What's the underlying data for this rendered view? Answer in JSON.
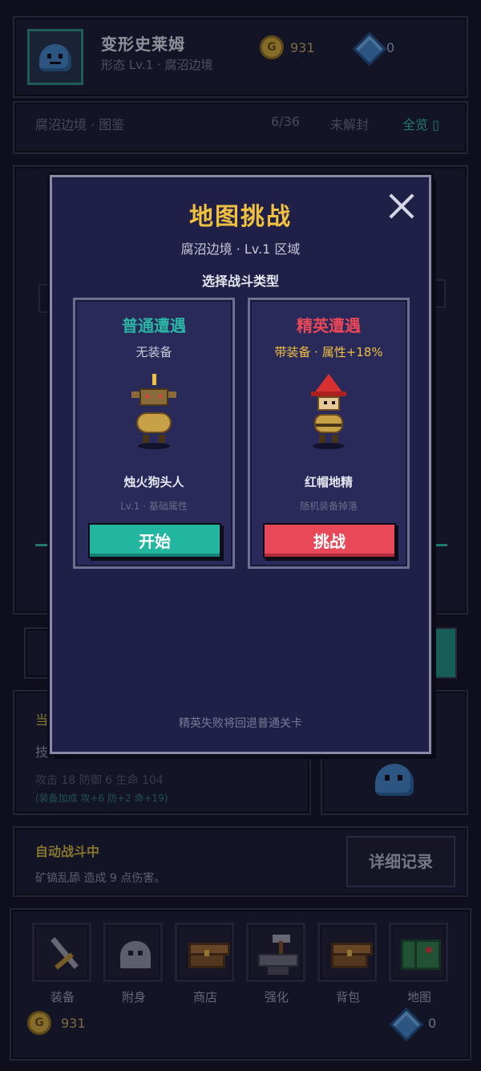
{
  "header": {
    "name": "变形史莱姆",
    "subtitle": "形态 Lv.1 · 腐沼边境",
    "gold": "931",
    "gems": "0"
  },
  "subheader": {
    "area": "腐沼边境 · 图鉴",
    "progress": "6/36",
    "locked": "未解封",
    "view_all": "全览 ▯"
  },
  "stats": {
    "label_current": "当",
    "label_skill": "技",
    "line": "攻击 18  防御 6  生命 104",
    "bonus": "(装备加成 攻+6 防+2 命+19)"
  },
  "log": {
    "title": "自动战斗中",
    "text": "矿镐乱舔 造成 9 点伤害。",
    "detail_button": "详细记录"
  },
  "nav": {
    "items": [
      {
        "label": "装备"
      },
      {
        "label": "附身"
      },
      {
        "label": "商店"
      },
      {
        "label": "强化"
      },
      {
        "label": "背包"
      },
      {
        "label": "地图"
      }
    ],
    "gold": "931",
    "gems": "0"
  },
  "modal": {
    "title": "地图挑战",
    "subtitle": "腐沼边境 · Lv.1 区域",
    "prompt": "选择战斗类型",
    "footer": "精英失败将回退普通关卡",
    "cards": [
      {
        "title": "普通遭遇",
        "tag": "无装备",
        "monster": "烛火狗头人",
        "desc": "Lv.1 · 基础属性",
        "button": "开始",
        "title_color": "#2bb5a5"
      },
      {
        "title": "精英遭遇",
        "tag": "带装备 · 属性+18%",
        "monster": "红帽地精",
        "desc": "随机装备掉落",
        "button": "挑战",
        "title_color": "#e84858"
      }
    ]
  },
  "colors": {
    "accent_teal": "#2bb5a5",
    "accent_red": "#e84858",
    "title_gold": "#f0c040"
  }
}
